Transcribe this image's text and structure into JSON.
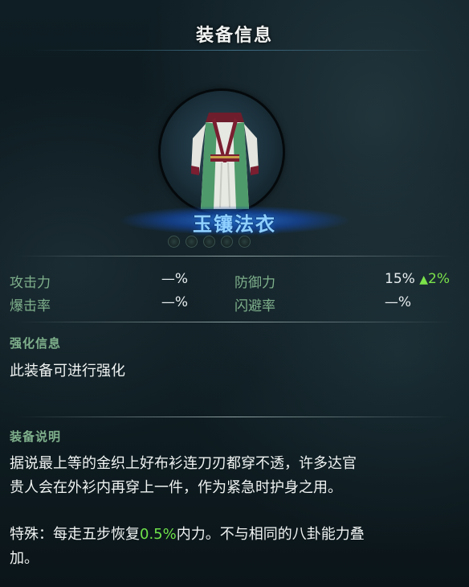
{
  "panel": {
    "title": "装备信息"
  },
  "item": {
    "name": "玉镶法衣",
    "icon": "robe-icon",
    "slot_count": 5
  },
  "stats": {
    "attack": {
      "label": "攻击力",
      "value": "—%"
    },
    "defense": {
      "label": "防御力",
      "value": "15%",
      "bonus": "2%",
      "bonus_icon": "up-arrow-icon"
    },
    "crit": {
      "label": "爆击率",
      "value": "—%"
    },
    "dodge": {
      "label": "闪避率",
      "value": "—%"
    }
  },
  "enhance": {
    "title": "强化信息",
    "text": "此装备可进行强化"
  },
  "description": {
    "title": "装备说明",
    "line1": "据说最上等的金织上好布衫连刀刃都穿不透，许多达官",
    "line2": "贵人会在外衫内再穿上一件，作为紧急时护身之用。",
    "special_prefix": "特殊：每走五步恢复",
    "special_value": "0.5%",
    "special_suffix": "内力。不与相同的八卦能力叠",
    "special_line2": "加。"
  },
  "colors": {
    "label_green": "#7fb08c",
    "highlight_green": "#6ee04a",
    "name_blue": "#8fd0ff"
  }
}
